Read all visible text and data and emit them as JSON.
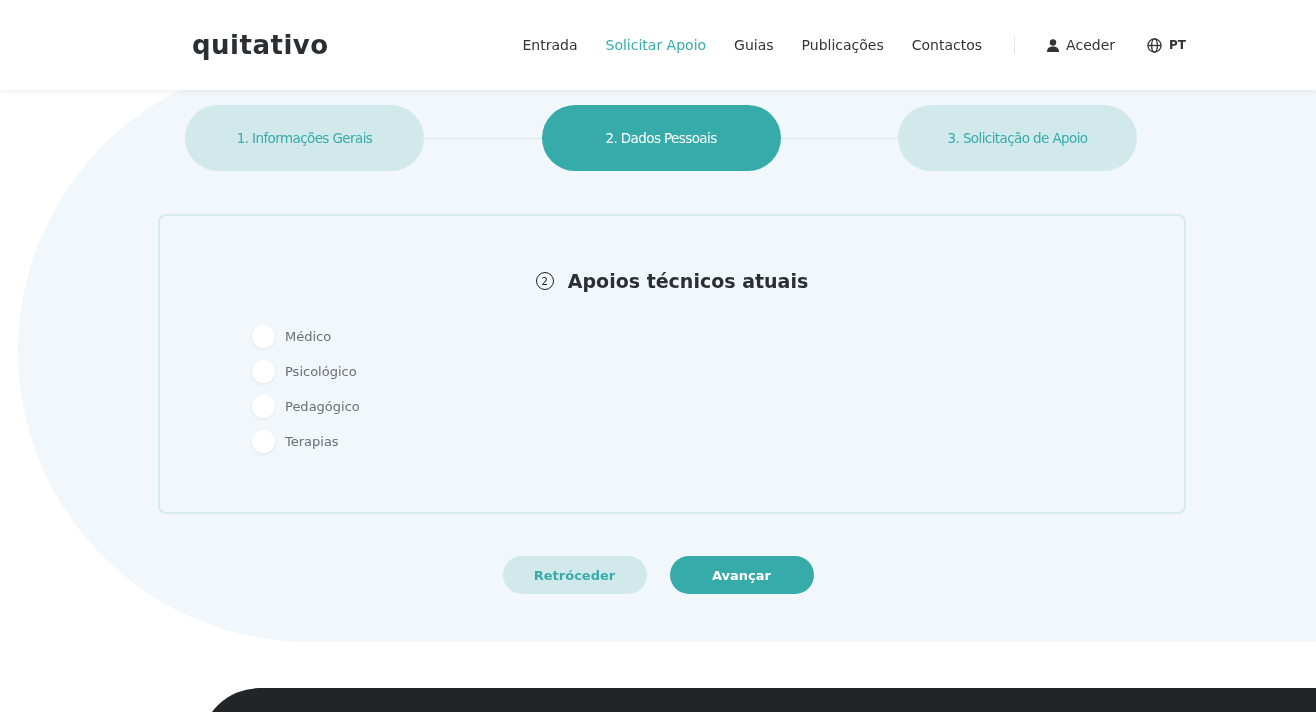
{
  "header": {
    "logo": "quitativo",
    "nav": [
      {
        "label": "Entrada",
        "selected": false
      },
      {
        "label": "Solicitar Apoio",
        "selected": true
      },
      {
        "label": "Guias",
        "selected": false
      },
      {
        "label": "Publicações",
        "selected": false
      },
      {
        "label": "Contactos",
        "selected": false
      }
    ],
    "login": "Aceder",
    "language": "PT"
  },
  "steps": [
    {
      "label": "1. Informações Gerais",
      "selected": false
    },
    {
      "label": "2. Dados Pessoais",
      "selected": true
    },
    {
      "label": "3. Solicitação de Apoio",
      "selected": false
    }
  ],
  "section": {
    "number": "2",
    "title": "Apoios técnicos atuais",
    "options": [
      {
        "label": "Médico",
        "checked": false
      },
      {
        "label": "Psicológico",
        "checked": false
      },
      {
        "label": "Pedagógico",
        "checked": false
      },
      {
        "label": "Terapias",
        "checked": false
      }
    ]
  },
  "buttons": {
    "back": "Retróceder",
    "next": "Avançar"
  }
}
